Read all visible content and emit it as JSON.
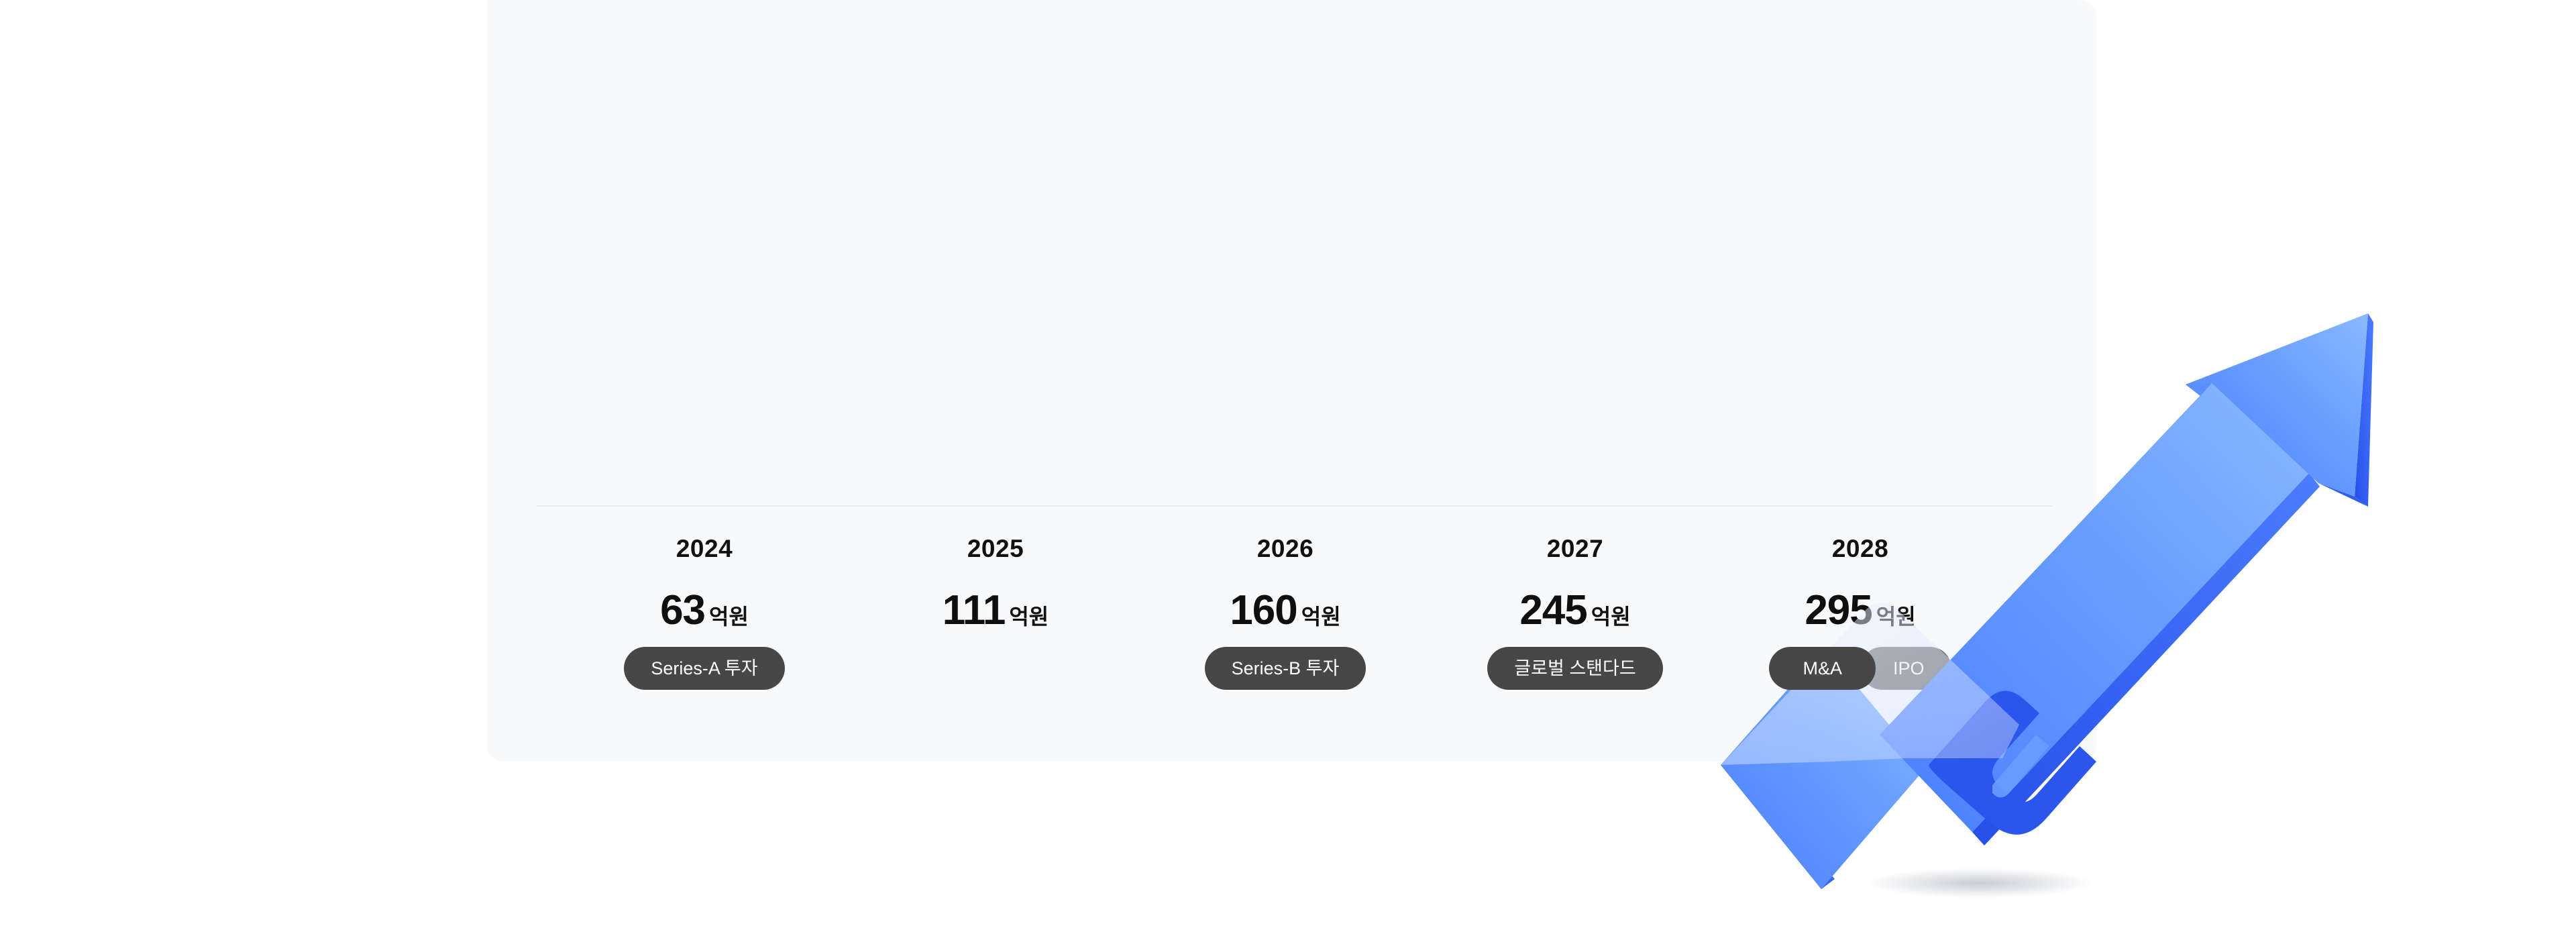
{
  "milestones": [
    {
      "year": "2024",
      "amount": "63",
      "unit": "억원",
      "badges": [
        "Series-A 투자"
      ]
    },
    {
      "year": "2025",
      "amount": "111",
      "unit": "억원",
      "badges": []
    },
    {
      "year": "2026",
      "amount": "160",
      "unit": "억원",
      "badges": [
        "Series-B 투자"
      ]
    },
    {
      "year": "2027",
      "amount": "245",
      "unit": "억원",
      "badges": [
        "글로벌 스탠다드"
      ]
    },
    {
      "year": "2028",
      "amount": "295",
      "unit": "억원",
      "badges": [
        "M&A",
        "IPO"
      ]
    }
  ],
  "colors": {
    "panel": "#f8f9fb",
    "badge_primary": "#474747",
    "badge_secondary": "#747474",
    "arrow_light": "#7fb2ff",
    "arrow_main": "#4f86ff",
    "arrow_dark": "#2d5cf2"
  },
  "decoration": {
    "icon": "growth-arrow-icon"
  }
}
